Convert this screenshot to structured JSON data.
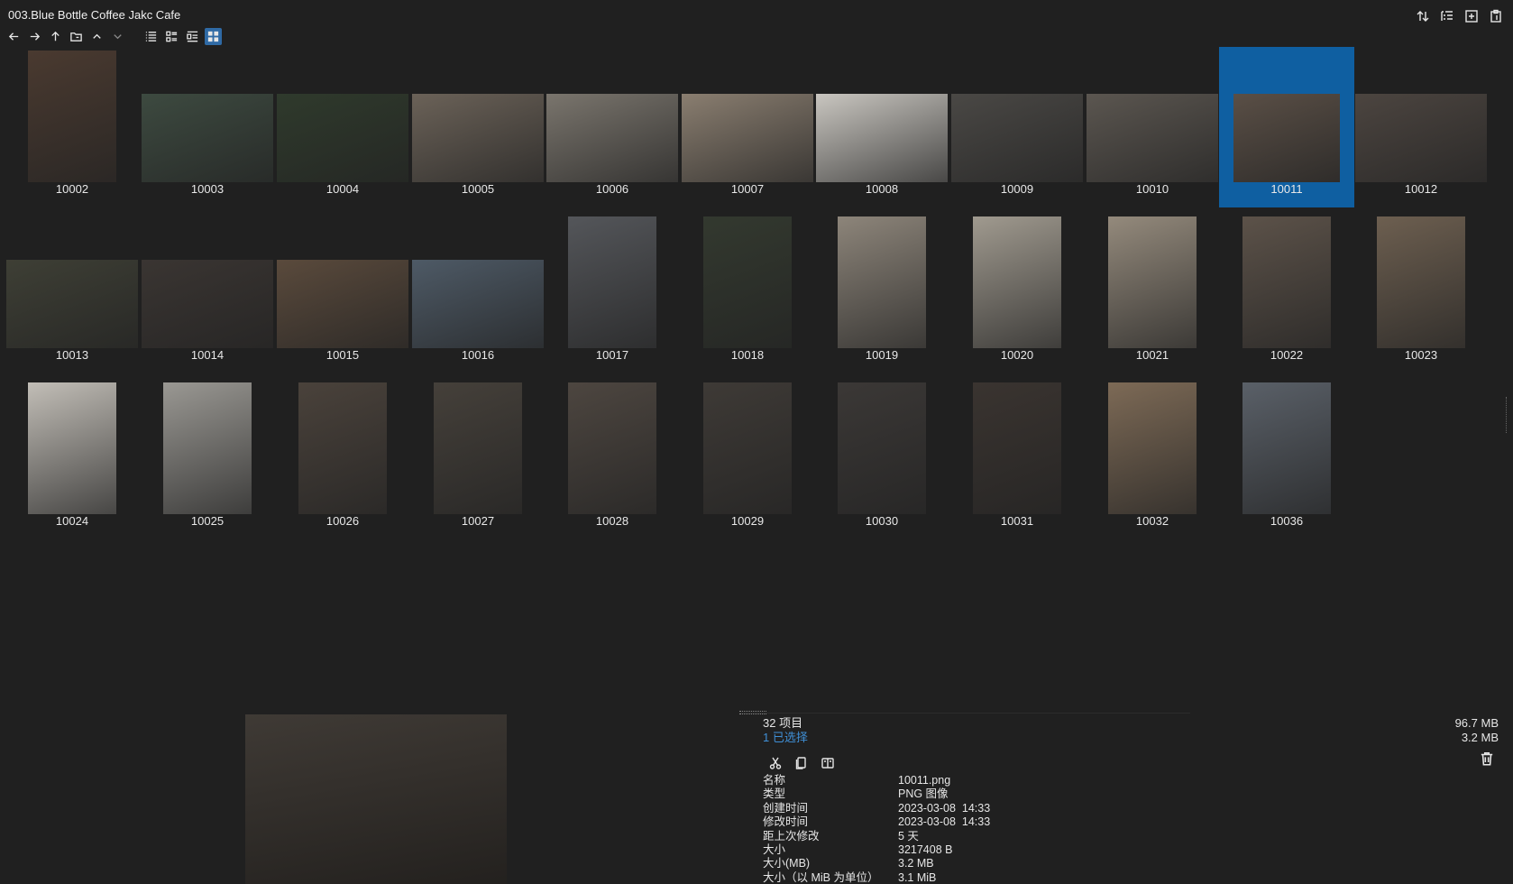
{
  "window": {
    "title": "003.Blue Bottle Coffee Jakc Cafe"
  },
  "toolbar": {
    "icons": [
      "back-arrow-icon",
      "forward-arrow-icon",
      "up-arrow-icon",
      "folder-icon",
      "chevron-up-icon",
      "chevron-down-icon",
      "details-view-icon",
      "list-view-icon",
      "tiles-view-icon",
      "grid-view-icon"
    ]
  },
  "top_right_icons": [
    "sort-icon",
    "list-icon",
    "new-window-icon",
    "clipboard-icon"
  ],
  "files": [
    {
      "name": "10002",
      "orient": "p",
      "color": "#4a3a30"
    },
    {
      "name": "10003",
      "orient": "l",
      "color": "#3d4a40"
    },
    {
      "name": "10004",
      "orient": "l",
      "color": "#2f3a2c"
    },
    {
      "name": "10005",
      "orient": "l",
      "color": "#6b6258"
    },
    {
      "name": "10006",
      "orient": "l",
      "color": "#7a756d"
    },
    {
      "name": "10007",
      "orient": "l",
      "color": "#8a7e70"
    },
    {
      "name": "10008",
      "orient": "l",
      "color": "#c9c6c0"
    },
    {
      "name": "10009",
      "orient": "l",
      "color": "#4a4845"
    },
    {
      "name": "10010",
      "orient": "l",
      "color": "#5b5650"
    },
    {
      "name": "10011",
      "orient": "sel",
      "color": "#5a4f46",
      "selected": true
    },
    {
      "name": "10012",
      "orient": "l",
      "color": "#4c4540"
    },
    {
      "name": "10013",
      "orient": "l",
      "color": "#3e3f35"
    },
    {
      "name": "10014",
      "orient": "l",
      "color": "#3a3532"
    },
    {
      "name": "10015",
      "orient": "l",
      "color": "#5a4a3c"
    },
    {
      "name": "10016",
      "orient": "l",
      "color": "#4e5a66"
    },
    {
      "name": "10017",
      "orient": "p",
      "color": "#54565a"
    },
    {
      "name": "10018",
      "orient": "p",
      "color": "#33392f"
    },
    {
      "name": "10019",
      "orient": "p",
      "color": "#8d857a"
    },
    {
      "name": "10020",
      "orient": "p",
      "color": "#a09a8f"
    },
    {
      "name": "10021",
      "orient": "p",
      "color": "#948a7c"
    },
    {
      "name": "10022",
      "orient": "p",
      "color": "#5c5249"
    },
    {
      "name": "10023",
      "orient": "p",
      "color": "#6d5f50"
    },
    {
      "name": "10024",
      "orient": "p",
      "color": "#c2beb7"
    },
    {
      "name": "10025",
      "orient": "p",
      "color": "#9a9893"
    },
    {
      "name": "10026",
      "orient": "p",
      "color": "#4a423b"
    },
    {
      "name": "10027",
      "orient": "p",
      "color": "#45403a"
    },
    {
      "name": "10028",
      "orient": "p",
      "color": "#4d4640"
    },
    {
      "name": "10029",
      "orient": "p",
      "color": "#3e3a36"
    },
    {
      "name": "10030",
      "orient": "p",
      "color": "#3b3836"
    },
    {
      "name": "10031",
      "orient": "p",
      "color": "#3a3430"
    },
    {
      "name": "10032",
      "orient": "p",
      "color": "#7d6a56"
    },
    {
      "name": "10036",
      "orient": "p",
      "color": "#5a6068"
    }
  ],
  "details": {
    "count": "32 项目",
    "selected": "1 已选择",
    "total_size": "96.7 MB",
    "selected_size": "3.2 MB",
    "action_icons": [
      "cut-icon",
      "copy-icon",
      "paste-icon"
    ],
    "props": [
      {
        "k": "名称",
        "v": "10011.png"
      },
      {
        "k": "类型",
        "v": "PNG 图像"
      },
      {
        "k": "创建时间",
        "v": "2023-03-08  14:33"
      },
      {
        "k": "修改时间",
        "v": "2023-03-08  14:33"
      },
      {
        "k": "距上次修改",
        "v": "5 天"
      },
      {
        "k": "大小",
        "v": "3217408 B"
      },
      {
        "k": "大小(MB)",
        "v": "3.2 MB"
      },
      {
        "k": "大小（以 MiB 为单位）",
        "v": "3.1 MiB"
      }
    ]
  },
  "preview": {
    "color": "#3f3a35"
  }
}
